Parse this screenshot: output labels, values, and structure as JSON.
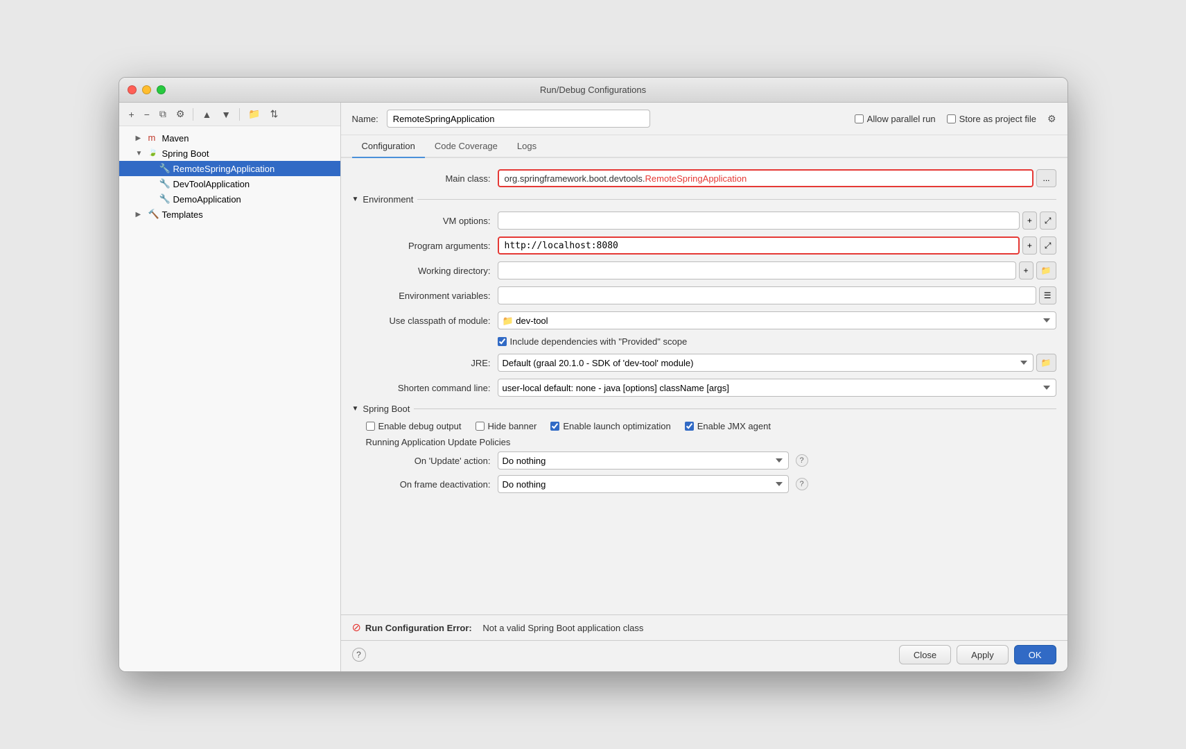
{
  "dialog": {
    "title": "Run/Debug Configurations",
    "traffic_lights": [
      "close",
      "minimize",
      "maximize"
    ]
  },
  "toolbar": {
    "add_label": "+",
    "remove_label": "−",
    "copy_label": "⧉",
    "settings_label": "⚙",
    "up_label": "▲",
    "down_label": "▼",
    "folder_label": "📁",
    "sort_label": "⇅"
  },
  "tree": {
    "items": [
      {
        "id": "maven",
        "label": "Maven",
        "indent": 1,
        "icon": "m",
        "expanded": true,
        "selected": false
      },
      {
        "id": "springboot",
        "label": "Spring Boot",
        "indent": 1,
        "icon": "leaf",
        "expanded": true,
        "selected": false
      },
      {
        "id": "remote-spring",
        "label": "RemoteSpringApplication",
        "indent": 2,
        "icon": "run",
        "selected": true
      },
      {
        "id": "devtool",
        "label": "DevToolApplication",
        "indent": 2,
        "icon": "run",
        "selected": false
      },
      {
        "id": "demo",
        "label": "DemoApplication",
        "indent": 2,
        "icon": "run",
        "selected": false
      },
      {
        "id": "templates",
        "label": "Templates",
        "indent": 1,
        "icon": "wrench",
        "expanded": false,
        "selected": false
      }
    ]
  },
  "header": {
    "name_label": "Name:",
    "name_value": "RemoteSpringApplication",
    "allow_parallel_label": "Allow parallel run",
    "store_project_label": "Store as project file"
  },
  "tabs": [
    {
      "id": "configuration",
      "label": "Configuration",
      "active": true
    },
    {
      "id": "code-coverage",
      "label": "Code Coverage",
      "active": false
    },
    {
      "id": "logs",
      "label": "Logs",
      "active": false
    }
  ],
  "form": {
    "main_class_label": "Main class:",
    "main_class_prefix": "org.springframework.boot.devtools.",
    "main_class_suffix": "RemoteSpringApplication",
    "environment_section": "Environment",
    "vm_options_label": "VM options:",
    "vm_options_value": "",
    "program_args_label": "Program arguments:",
    "program_args_value": "http://localhost:8080",
    "working_dir_label": "Working directory:",
    "working_dir_value": "",
    "env_vars_label": "Environment variables:",
    "env_vars_value": "",
    "classpath_label": "Use classpath of module:",
    "classpath_value": "dev-tool",
    "include_deps_label": "Include dependencies with \"Provided\" scope",
    "jre_label": "JRE:",
    "jre_value": "Default (graal 20.1.0 - SDK of 'dev-tool' module)",
    "shorten_cmd_label": "Shorten command line:",
    "shorten_cmd_value": "user-local default: none - java [options] className [args]",
    "spring_boot_section": "Spring Boot",
    "enable_debug_label": "Enable debug output",
    "hide_banner_label": "Hide banner",
    "enable_launch_label": "Enable launch optimization",
    "enable_jmx_label": "Enable JMX agent",
    "running_policies_label": "Running Application Update Policies",
    "on_update_label": "On 'Update' action:",
    "on_update_value": "Do nothing",
    "on_frame_label": "On frame deactivation:",
    "on_frame_value": "Do nothing"
  },
  "bottom": {
    "error_label": "Run Configuration Error:",
    "error_detail": "Not a valid Spring Boot application class",
    "close_label": "Close",
    "apply_label": "Apply",
    "ok_label": "OK"
  },
  "footer": {
    "help_icon": "?"
  }
}
